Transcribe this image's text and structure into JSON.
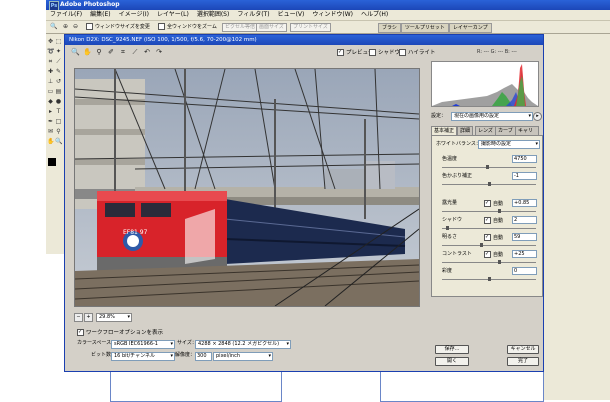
{
  "app": {
    "title": "Adobe Photoshop",
    "logo_icon": "photoshop-logo-icon"
  },
  "menu": [
    "ファイル(F)",
    "編集(E)",
    "イメージ(I)",
    "レイヤー(L)",
    "選択範囲(S)",
    "フィルタ(T)",
    "ビュー(V)",
    "ウィンドウ(W)",
    "ヘルプ(H)"
  ],
  "options_bar": {
    "resize_windows": "ウィンドウサイズを変更",
    "all_windows_zoom": "全ウィンドウをズーム",
    "actual_pixels": "ピクセル等倍",
    "fit_screen": "画面サイズ",
    "print_size": "プリントサイズ"
  },
  "palette_tabs": [
    "ブラシ",
    "ツールプリセット",
    "レイヤーカンプ"
  ],
  "raw_dialog": {
    "title": "Nikon D2X:  DSC_9245.NEF  (ISO 100, 1/500, f/5.6, 70-200@102 mm)",
    "preview_label": "プレビュー",
    "preview_checked": true,
    "shadow_label": "シャドウ",
    "shadow_checked": false,
    "highlight_label": "ハイライト",
    "highlight_checked": false,
    "rgb_readout": "R:  ---  G:  ---  B:  ---",
    "zoom": "29.8%",
    "settings_label": "設定：",
    "settings_value": "現在の画像用の設定",
    "tabs": [
      "基本補正",
      "詳細",
      "レンズ",
      "カーブ",
      "キャリブレーション"
    ],
    "white_balance_label": "ホワイトバランス：",
    "white_balance_value": "撮影時の設定",
    "temperature_label": "色温度",
    "temperature_value": "4750",
    "tint_label": "色かぶり補正",
    "tint_value": "-1",
    "exposure_label": "露光量",
    "exposure_value": "+0.85",
    "shadows_label": "シャドウ",
    "shadows_value": "2",
    "brightness_label": "明るさ",
    "brightness_value": "59",
    "contrast_label": "コントラスト",
    "contrast_value": "+25",
    "saturation_label": "彩度",
    "saturation_value": "0",
    "auto_label": "自動",
    "workflow_label": "ワークフローオプションを表示",
    "workflow_checked": true,
    "colorspace_label": "カラースペース：",
    "colorspace_value": "sRGB IEC61966-1",
    "size_label": "サイズ：",
    "size_value": "4288 × 2848  (12.2 メガピクセル)",
    "bitdepth_label": "ビット数：",
    "bitdepth_value": "16 bit/チャンネル",
    "resolution_label": "解像度：",
    "resolution_value": "300",
    "resolution_unit": "pixel/inch",
    "buttons": {
      "save": "保存...",
      "cancel": "キャンセル",
      "open": "開く",
      "done": "完了"
    },
    "photo": {
      "locomotive_number": "EF81 97"
    }
  }
}
